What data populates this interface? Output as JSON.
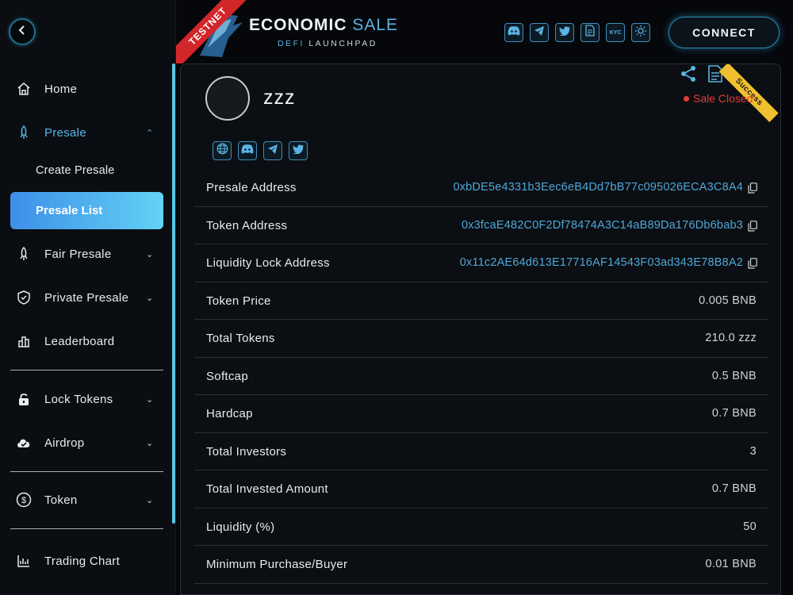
{
  "sidebar": {
    "back_icon": "chevron-left-icon",
    "items": [
      {
        "label": "Home",
        "icon": "home-icon"
      },
      {
        "label": "Presale",
        "icon": "rocket-icon",
        "expanded": true
      },
      {
        "label": "Fair Presale",
        "icon": "rocket-icon"
      },
      {
        "label": "Private Presale",
        "icon": "shield-icon"
      },
      {
        "label": "Leaderboard",
        "icon": "bar-chart-icon"
      },
      {
        "label": "Lock Tokens",
        "icon": "lock-icon"
      },
      {
        "label": "Airdrop",
        "icon": "cloud-check-icon"
      },
      {
        "label": "Token",
        "icon": "dollar-coin-icon"
      },
      {
        "label": "Trading Chart",
        "icon": "chart-icon"
      }
    ],
    "presale_sub": [
      {
        "label": "Create Presale"
      },
      {
        "label": "Presale List",
        "active": true
      }
    ]
  },
  "header": {
    "testnet_label": "TESTNET",
    "brand_main": "ECONOMIC",
    "brand_accent": "SALE",
    "brand_sub_accent": "DEFI",
    "brand_sub": "LAUNCHPAD",
    "social_icons": [
      "discord-icon",
      "telegram-icon",
      "twitter-icon",
      "document-icon",
      "kyc-icon",
      "sun-icon"
    ],
    "kyc_label": "KYC",
    "connect_label": "CONNECT"
  },
  "project": {
    "name": "zzz",
    "status_label": "Sale Closed",
    "badge_label": "Success",
    "links": [
      "globe-icon",
      "discord-icon",
      "telegram-icon",
      "twitter-icon"
    ],
    "details": [
      {
        "key": "Presale Address",
        "value": "0xbDE5e4331b3Eec6eB4Dd7bB77c095026ECA3C8A4",
        "is_address": true
      },
      {
        "key": "Token Address",
        "value": "0x3fcaE482C0F2Df78474A3C14aB89Da176Db6bab3",
        "is_address": true
      },
      {
        "key": "Liquidity Lock Address",
        "value": "0x11c2AE64d613E17716AF14543F03ad343E78B8A2",
        "is_address": true
      },
      {
        "key": "Token Price",
        "value": "0.005 BNB"
      },
      {
        "key": "Total Tokens",
        "value": "210.0 zzz"
      },
      {
        "key": "Softcap",
        "value": "0.5 BNB"
      },
      {
        "key": "Hardcap",
        "value": "0.7 BNB"
      },
      {
        "key": "Total Investors",
        "value": "3"
      },
      {
        "key": "Total Invested Amount",
        "value": "0.7 BNB"
      },
      {
        "key": "Liquidity (%)",
        "value": "50"
      },
      {
        "key": "Minimum Purchase/Buyer",
        "value": "0.01 BNB"
      }
    ]
  },
  "colors": {
    "accent": "#56b9e6",
    "active_gradient_start": "#3d8fe8",
    "active_gradient_end": "#63d2f5",
    "status_red": "#e33b3b",
    "badge_gold": "#f0c030",
    "testnet_red": "#d2262a"
  }
}
